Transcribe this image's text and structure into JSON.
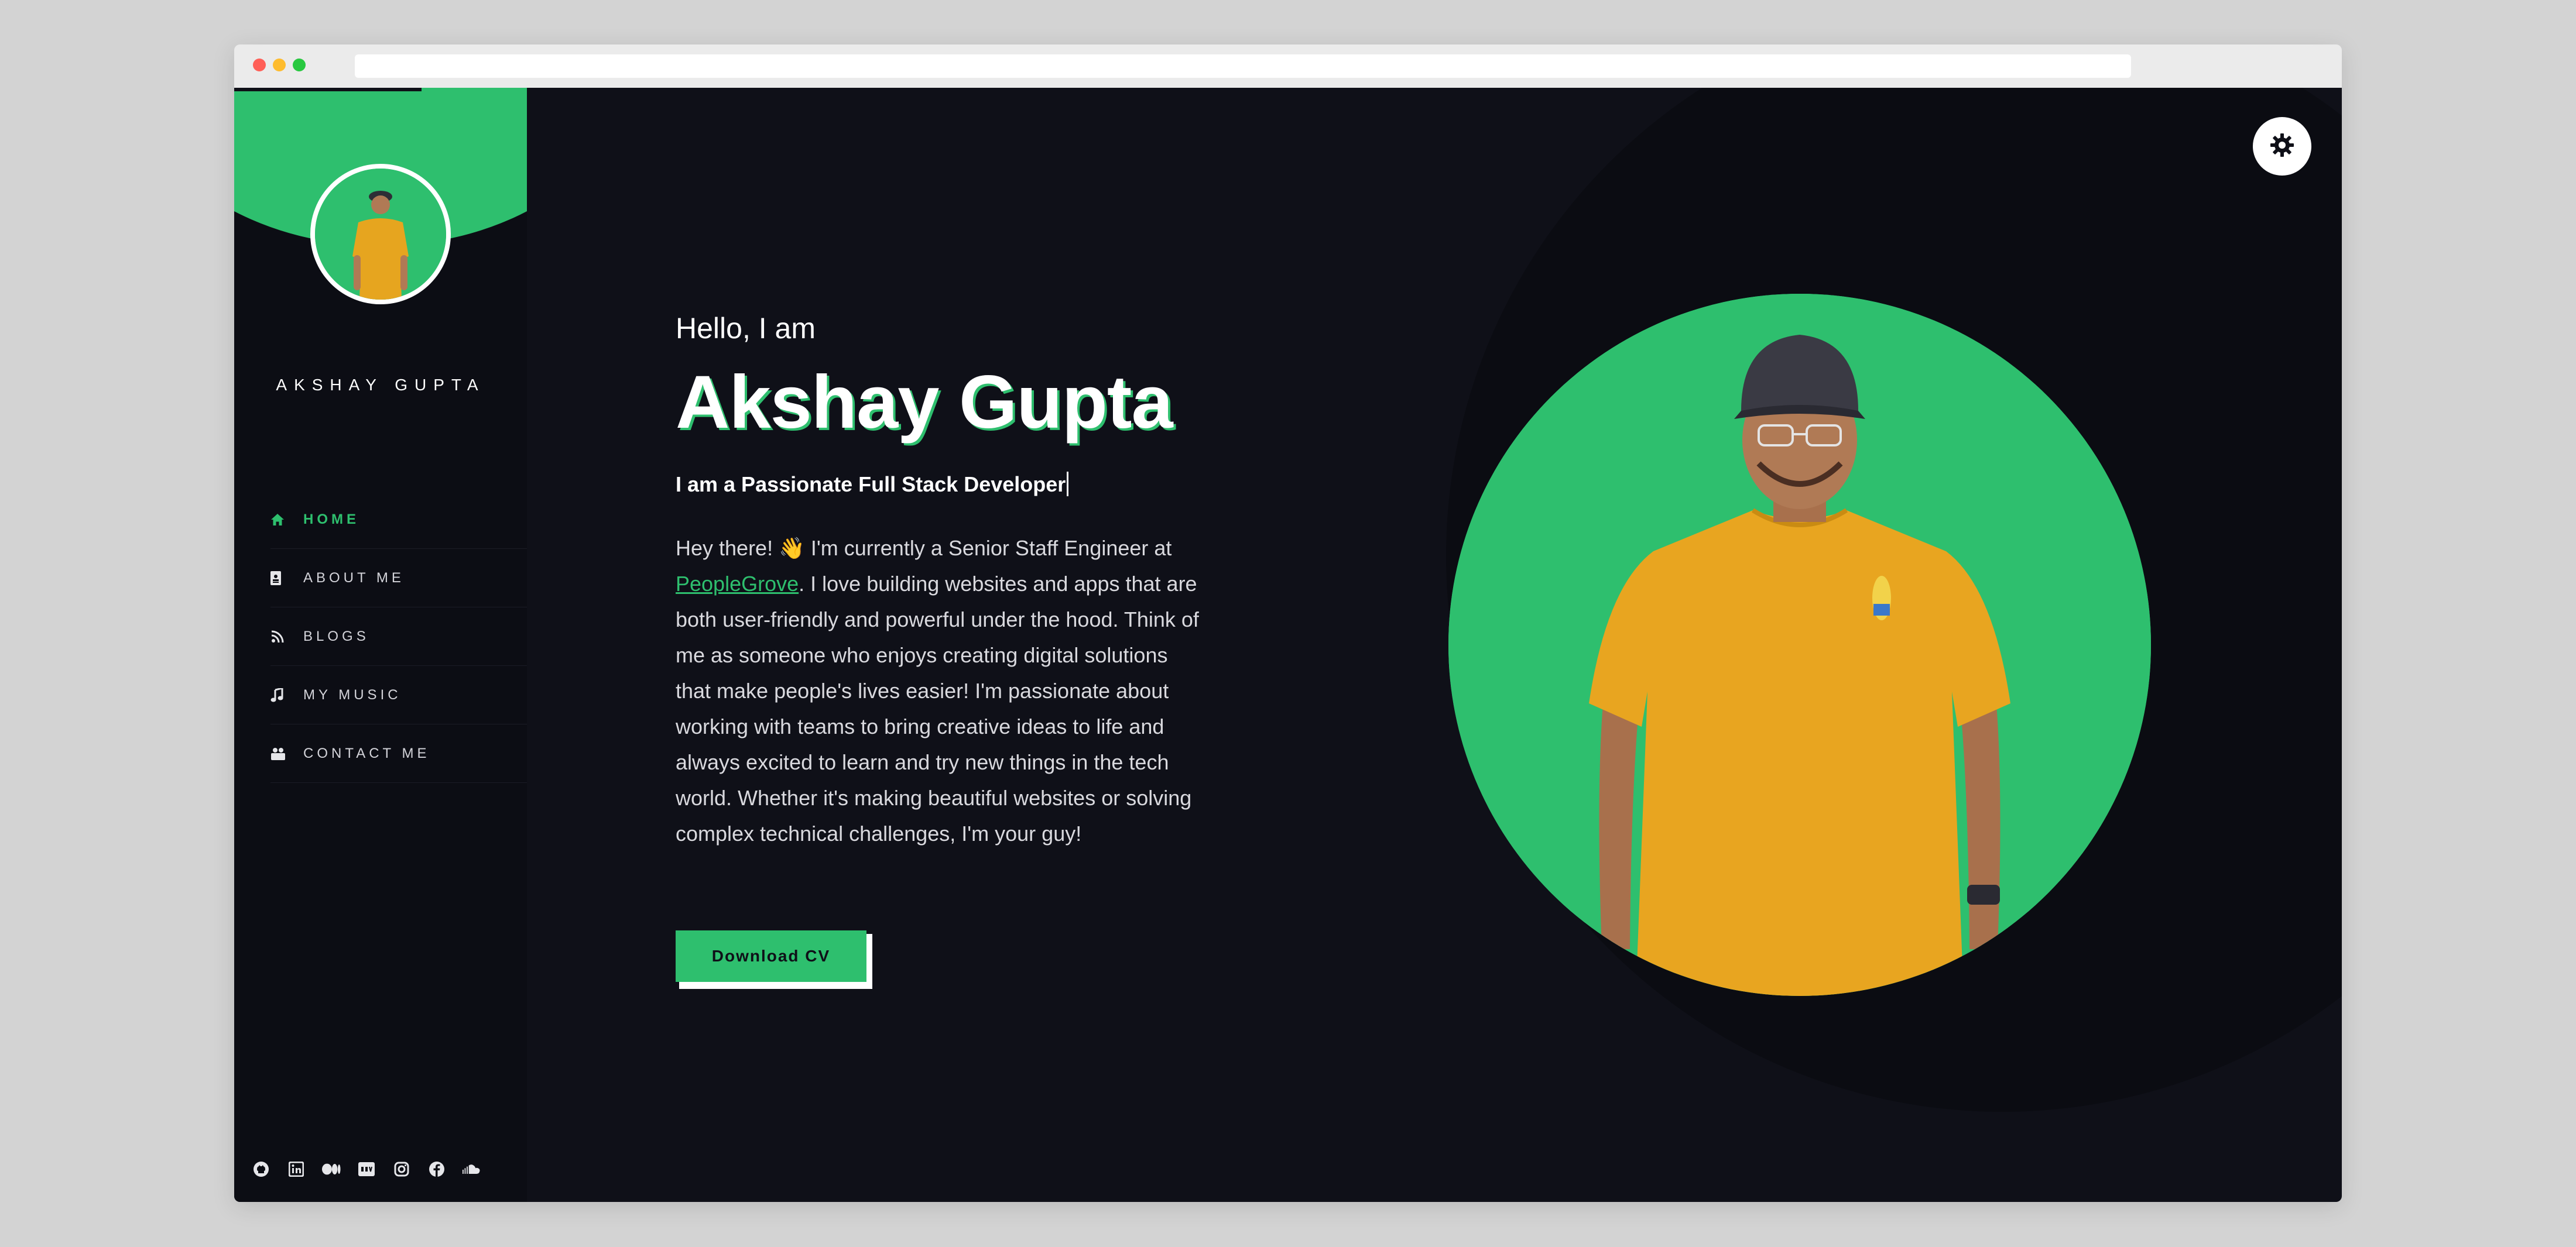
{
  "site": {
    "owner_name": "AKSHAY GUPTA",
    "accent_color": "#2ebf6e",
    "background_color": "#0f1018"
  },
  "sidebar": {
    "nav": [
      {
        "label": "HOME",
        "icon": "home-icon",
        "active": true
      },
      {
        "label": "ABOUT ME",
        "icon": "id-card-icon",
        "active": false
      },
      {
        "label": "BLOGS",
        "icon": "blog-rss-icon",
        "active": false
      },
      {
        "label": "MY MUSIC",
        "icon": "music-note-icon",
        "active": false
      },
      {
        "label": "CONTACT ME",
        "icon": "contact-icon",
        "active": false
      }
    ],
    "socials": [
      "github-icon",
      "linkedin-icon",
      "medium-icon",
      "dev-icon",
      "instagram-icon",
      "facebook-icon",
      "soundcloud-icon"
    ]
  },
  "hero": {
    "greeting": "Hello, I am",
    "name": "Akshay Gupta",
    "tagline": "I am a Passionate Full Stack Developer",
    "bio_before_link": "Hey there! 👋 I'm currently a Senior Staff Engineer at ",
    "bio_link": "PeopleGrove",
    "bio_after_link": ". I love building websites and apps that are both user-friendly and powerful under the hood. Think of me as someone who enjoys creating digital solutions that make people's lives easier! I'm passionate about working with teams to bring creative ideas to life and always excited to learn and try new things in the tech world. Whether it's making beautiful websites or solving complex technical challenges, I'm your guy!",
    "cta_label": "Download CV"
  },
  "controls": {
    "theme_toggle_icon": "gear-icon"
  }
}
